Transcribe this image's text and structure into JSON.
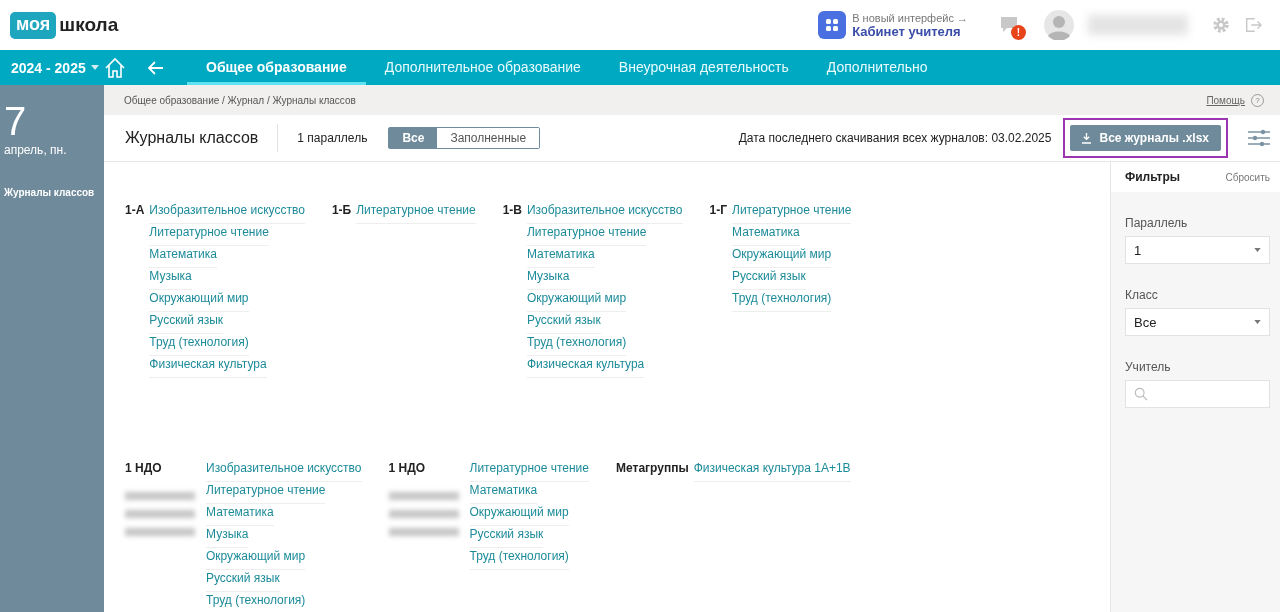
{
  "header": {
    "logo_badge": "моя",
    "logo_text": "школа",
    "new_ui_hint": "В новый интерфейс →",
    "new_ui_link": "Кабинет учителя",
    "notification_badge": "!"
  },
  "nav": {
    "year": "2024 - 2025",
    "tabs": [
      {
        "label": "Общее образование",
        "selected": true
      },
      {
        "label": "Дополнительное образование",
        "selected": false
      },
      {
        "label": "Внеурочная деятельность",
        "selected": false
      },
      {
        "label": "Дополнительно",
        "selected": false
      }
    ]
  },
  "sidebar": {
    "day": "7",
    "date": "апрель, пн.",
    "items": [
      "Журналы классов"
    ]
  },
  "breadcrumb": "Общее образование / Журнал / Журналы классов",
  "help": "Помощь",
  "help_icon": "?",
  "toolbar": {
    "title": "Журналы классов",
    "parallel": "1 параллель",
    "toggle": [
      {
        "label": "Все",
        "selected": true
      },
      {
        "label": "Заполненные",
        "selected": false
      }
    ],
    "last_download": "Дата последнего скачивания всех журналов: 03.02.2025",
    "download_button": "Все журналы .xlsx"
  },
  "rows": [
    {
      "groups": [
        {
          "label": "1-А",
          "redacted": false,
          "subjects": [
            "Изобразительное искусство",
            "Литературное чтение",
            "Математика",
            "Музыка",
            "Окружающий мир",
            "Русский язык",
            "Труд (технология)",
            "Физическая культура"
          ]
        },
        {
          "label": "1-Б",
          "redacted": false,
          "subjects": [
            "Литературное чтение"
          ]
        },
        {
          "label": "1-В",
          "redacted": false,
          "subjects": [
            "Изобразительное искусство",
            "Литературное чтение",
            "Математика",
            "Музыка",
            "Окружающий мир",
            "Русский язык",
            "Труд (технология)",
            "Физическая культура"
          ]
        },
        {
          "label": "1-Г",
          "redacted": false,
          "subjects": [
            "Литературное чтение",
            "Математика",
            "Окружающий мир",
            "Русский язык",
            "Труд (технология)"
          ]
        }
      ]
    },
    {
      "groups": [
        {
          "label": "1 НДО",
          "redacted": true,
          "subjects": [
            "Изобразительное искусство",
            "Литературное чтение",
            "Математика",
            "Музыка",
            "Окружающий мир",
            "Русский язык",
            "Труд (технология)"
          ]
        },
        {
          "label": "1 НДО",
          "redacted": true,
          "subjects": [
            "Литературное чтение",
            "Математика",
            "Окружающий мир",
            "Русский язык",
            "Труд (технология)"
          ]
        },
        {
          "label": "Метагруппы",
          "redacted": false,
          "subjects": [
            "Физическая культура 1А+1В"
          ]
        }
      ]
    }
  ],
  "filters": {
    "title": "Фильтры",
    "reset": "Сбросить",
    "fields": [
      {
        "kind": "select",
        "label": "Параллель",
        "value": "1"
      },
      {
        "kind": "select",
        "label": "Класс",
        "value": "Все"
      },
      {
        "kind": "search",
        "label": "Учитель"
      }
    ]
  }
}
